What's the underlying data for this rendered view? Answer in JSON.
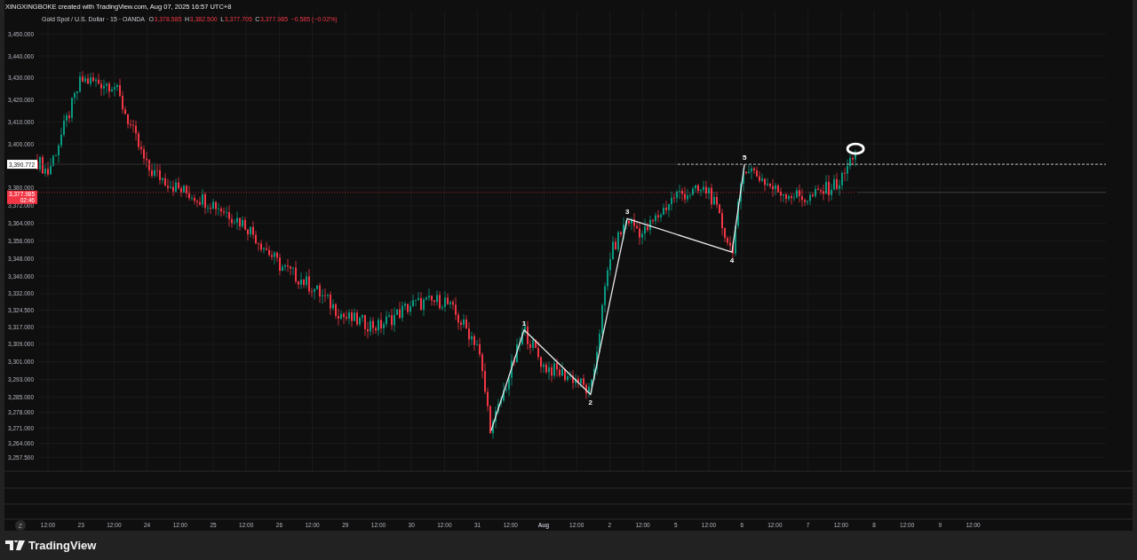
{
  "credit": "XINGXINGBOKE created with TradingView.com, Aug 07, 2025 16:57 UTC+8",
  "legend": {
    "symbol": "Gold Spot / U.S. Dollar · 15 · OANDA",
    "ohlc": [
      {
        "label": "O",
        "value": "3,378.585"
      },
      {
        "label": "H",
        "value": "3,382.500"
      },
      {
        "label": "L",
        "value": "3,377.705"
      },
      {
        "label": "C",
        "value": "3,377.985"
      }
    ],
    "change": "−0.585 (−0.02%)"
  },
  "chart": {
    "price_axis": [
      "3,450.000",
      "3,440.000",
      "3,430.000",
      "3,420.000",
      "3,410.000",
      "3,400.000",
      "3,380.000",
      "3,372.000",
      "3,364.000",
      "3,356.000",
      "3,348.000",
      "3,340.000",
      "3,332.000",
      "3,324.500",
      "3,317.000",
      "3,309.000",
      "3,301.000",
      "3,293.000",
      "3,285.000",
      "3,278.000",
      "3,271.000",
      "3,264.000",
      "3,257.500"
    ],
    "time_axis": [
      "12:00",
      "23",
      "12:00",
      "24",
      "12:00",
      "25",
      "12:00",
      "26",
      "12:00",
      "29",
      "12:00",
      "30",
      "12:00",
      "31",
      "12:00",
      "Aug",
      "12:00",
      "2",
      "12:00",
      "5",
      "12:00",
      "6",
      "12:00",
      "7",
      "12:00",
      "8",
      "12:00",
      "9",
      "12:00"
    ],
    "wave_labels": [
      "1",
      "2",
      "3",
      "4",
      "5"
    ],
    "marked_price": "3,390.772",
    "last_price": {
      "value": "3,377.985",
      "countdown": "02:46"
    }
  },
  "axis_button": "Z",
  "footer": {
    "brand": "TradingView"
  }
}
